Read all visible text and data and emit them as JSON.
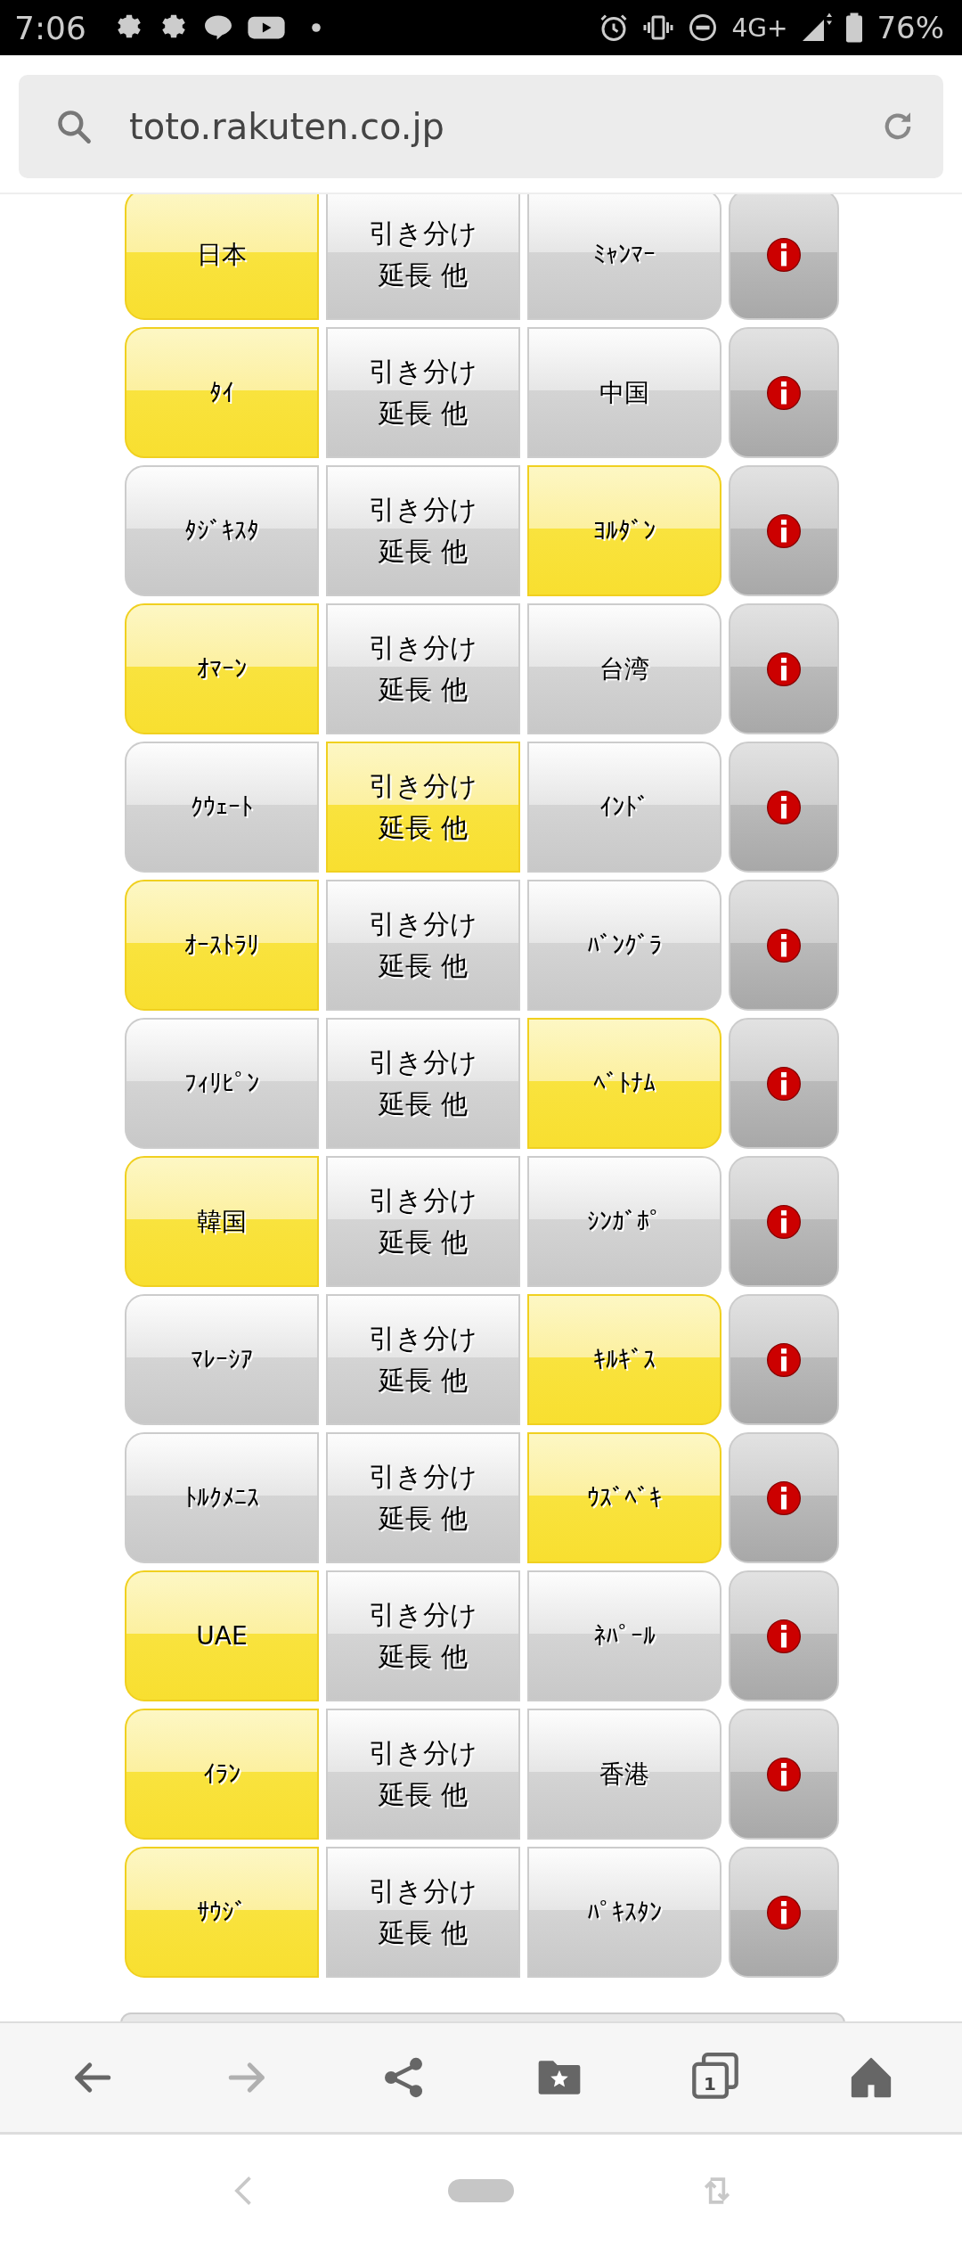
{
  "status_bar": {
    "time": "7:06",
    "network": "4G+",
    "battery": "76%"
  },
  "address_bar": {
    "url": "toto.rakuten.co.jp"
  },
  "matches": [
    {
      "home": {
        "label": "日本",
        "selected": true
      },
      "draw": {
        "lines": [
          "引き分け",
          "延長 他"
        ],
        "selected": false
      },
      "away": {
        "label": "ﾐｬﾝﾏｰ",
        "selected": false
      }
    },
    {
      "home": {
        "label": "ﾀｲ",
        "selected": true
      },
      "draw": {
        "lines": [
          "引き分け",
          "延長 他"
        ],
        "selected": false
      },
      "away": {
        "label": "中国",
        "selected": false
      }
    },
    {
      "home": {
        "label": "ﾀｼﾞｷｽﾀ",
        "selected": false
      },
      "draw": {
        "lines": [
          "引き分け",
          "延長 他"
        ],
        "selected": false
      },
      "away": {
        "label": "ﾖﾙﾀﾞﾝ",
        "selected": true
      }
    },
    {
      "home": {
        "label": "ｵﾏｰﾝ",
        "selected": true
      },
      "draw": {
        "lines": [
          "引き分け",
          "延長 他"
        ],
        "selected": false
      },
      "away": {
        "label": "台湾",
        "selected": false
      }
    },
    {
      "home": {
        "label": "ｸｳｪｰﾄ",
        "selected": false
      },
      "draw": {
        "lines": [
          "引き分け",
          "延長 他"
        ],
        "selected": true
      },
      "away": {
        "label": "ｲﾝﾄﾞ",
        "selected": false
      }
    },
    {
      "home": {
        "label": "ｵｰｽﾄﾗﾘ",
        "selected": true
      },
      "draw": {
        "lines": [
          "引き分け",
          "延長 他"
        ],
        "selected": false
      },
      "away": {
        "label": "ﾊﾞﾝｸﾞﾗ",
        "selected": false
      }
    },
    {
      "home": {
        "label": "ﾌｨﾘﾋﾟﾝ",
        "selected": false
      },
      "draw": {
        "lines": [
          "引き分け",
          "延長 他"
        ],
        "selected": false
      },
      "away": {
        "label": "ﾍﾞﾄﾅﾑ",
        "selected": true
      }
    },
    {
      "home": {
        "label": "韓国",
        "selected": true
      },
      "draw": {
        "lines": [
          "引き分け",
          "延長 他"
        ],
        "selected": false
      },
      "away": {
        "label": "ｼﾝｶﾞﾎﾟ",
        "selected": false
      }
    },
    {
      "home": {
        "label": "ﾏﾚｰｼｱ",
        "selected": false
      },
      "draw": {
        "lines": [
          "引き分け",
          "延長 他"
        ],
        "selected": false
      },
      "away": {
        "label": "ｷﾙｷﾞｽ",
        "selected": true
      }
    },
    {
      "home": {
        "label": "ﾄﾙｸﾒﾆｽ",
        "selected": false
      },
      "draw": {
        "lines": [
          "引き分け",
          "延長 他"
        ],
        "selected": false
      },
      "away": {
        "label": "ｳｽﾞﾍﾞｷ",
        "selected": true
      }
    },
    {
      "home": {
        "label": "UAE",
        "selected": true
      },
      "draw": {
        "lines": [
          "引き分け",
          "延長 他"
        ],
        "selected": false
      },
      "away": {
        "label": "ﾈﾊﾟｰﾙ",
        "selected": false
      }
    },
    {
      "home": {
        "label": "ｲﾗﾝ",
        "selected": true
      },
      "draw": {
        "lines": [
          "引き分け",
          "延長 他"
        ],
        "selected": false
      },
      "away": {
        "label": "香港",
        "selected": false
      }
    },
    {
      "home": {
        "label": "ｻｳｼﾞ",
        "selected": true
      },
      "draw": {
        "lines": [
          "引き分け",
          "延長 他"
        ],
        "selected": false
      },
      "away": {
        "label": "ﾊﾟｷｽﾀﾝ",
        "selected": false
      }
    }
  ],
  "toolbar": {
    "tab_count": "1"
  }
}
